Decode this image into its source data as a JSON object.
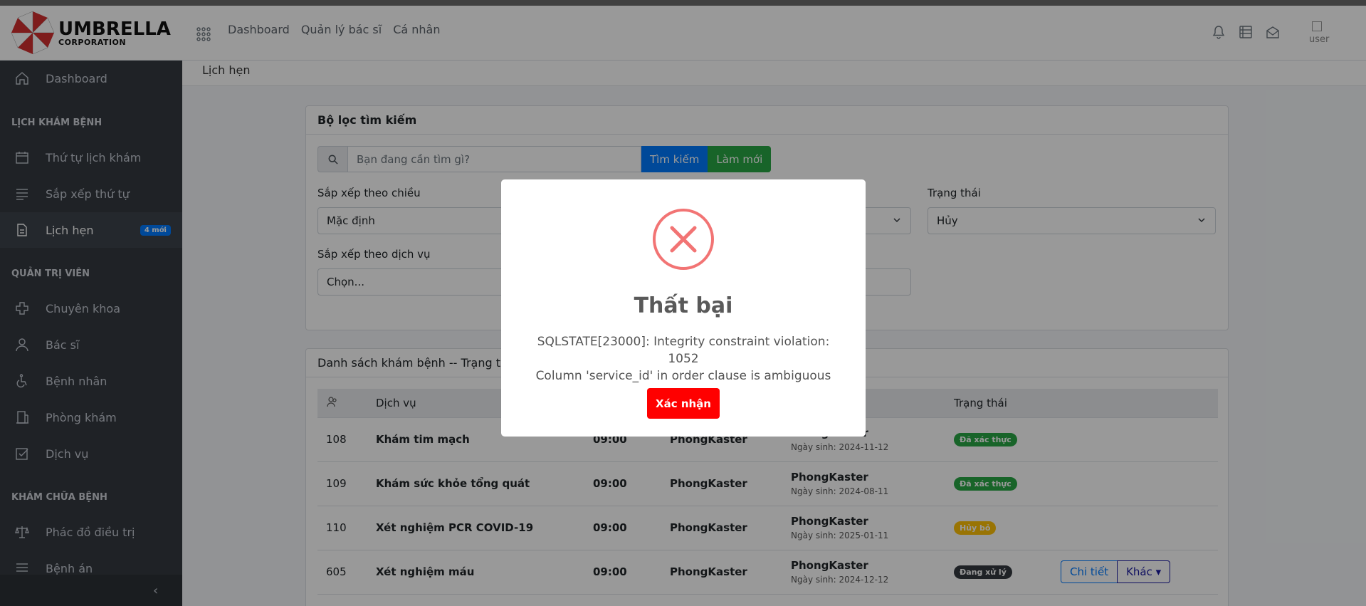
{
  "brand": {
    "line1": "UMBRELLA",
    "line2": "CORPORATION"
  },
  "topnav": [
    "Dashboard",
    "Quản lý bác sĩ",
    "Cá nhân"
  ],
  "avatar_alt": "user",
  "sidebar": {
    "dashboard": "Dashboard",
    "section1": "LỊCH KHÁM BỆNH",
    "item_order": "Thứ tự lịch khám",
    "item_sort": "Sắp xếp thứ tự",
    "item_appointments": "Lịch hẹn",
    "item_appointments_badge": "4 mới",
    "section2": "QUẢN TRỊ VIÊN",
    "item_specialty": "Chuyên khoa",
    "item_doctor": "Bác sĩ",
    "item_patient": "Bệnh nhân",
    "item_clinic": "Phòng khám",
    "item_service": "Dịch vụ",
    "section3": "KHÁM CHỮA BỆNH",
    "item_treatment": "Phác đồ điều trị",
    "item_record": "Bệnh án"
  },
  "breadcrumb": "Lịch hẹn",
  "filter": {
    "title": "Bộ lọc tìm kiếm",
    "search_placeholder": "Bạn đang cần tìm gì?",
    "search_button": "Tìm kiếm",
    "reset_button": "Làm mới",
    "sort_direction_label": "Sắp xếp theo chiều",
    "sort_direction_value": "Mặc định",
    "status_label": "Trạng thái",
    "status_value": "Hủy",
    "service_label": "Sắp xếp theo dịch vụ",
    "service_value": "Chọn..."
  },
  "list": {
    "title": "Danh sách khám bệnh -- Trạng thái: H",
    "headers": {
      "service": "Dịch vụ",
      "status": "Trạng thái"
    },
    "rows": [
      {
        "id": "108",
        "service": "Khám tim mạch",
        "time": "09:00",
        "doctor": "PhongKaster",
        "patient": "PhongKaster",
        "dob": "Ngày sinh: 2024-11-12",
        "status": "Đã xác thực",
        "status_color": "#28a745"
      },
      {
        "id": "109",
        "service": "Khám sức khỏe tổng quát",
        "time": "09:00",
        "doctor": "PhongKaster",
        "patient": "PhongKaster",
        "dob": "Ngày sinh: 2024-08-11",
        "status": "Đã xác thực",
        "status_color": "#28a745"
      },
      {
        "id": "110",
        "service": "Xét nghiệm PCR COVID-19",
        "time": "09:00",
        "doctor": "PhongKaster",
        "patient": "PhongKaster",
        "dob": "Ngày sinh: 2025-01-11",
        "status": "Hủy bỏ",
        "status_color": "#ffc107"
      },
      {
        "id": "605",
        "service": "Xét nghiệm máu",
        "time": "09:00",
        "doctor": "PhongKaster",
        "patient": "PhongKaster",
        "dob": "Ngày sinh: 2024-12-12",
        "status": "Đang xử lý",
        "status_color": "#343a40"
      }
    ],
    "detail_button": "Chi tiết",
    "more_button": "Khác"
  },
  "modal": {
    "title": "Thất bại",
    "message_line1": "SQLSTATE[23000]: Integrity constraint violation: 1052",
    "message_line2": "Column 'service_id' in order clause is ambiguous",
    "confirm": "Xác nhận"
  },
  "colors": {
    "error_red": "#f27474",
    "confirm_red": "#ff0000"
  }
}
